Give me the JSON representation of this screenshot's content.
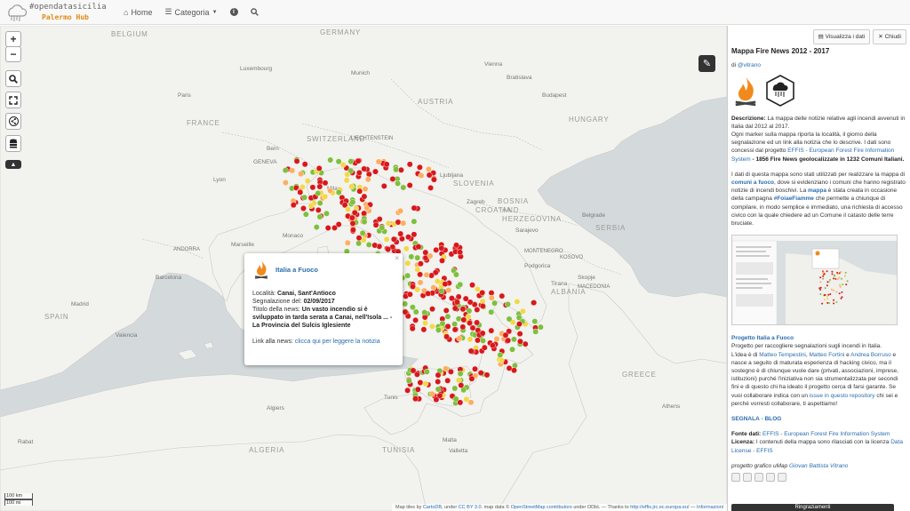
{
  "navbar": {
    "brand_title": "#opendatasicilia",
    "brand_subtitle": "Palermo Hub",
    "home_label": "Home",
    "categoria_label": "Categoria",
    "info_icon": "info-icon",
    "search_icon": "search-icon"
  },
  "map": {
    "labels": [
      {
        "text": "BELGIUM",
        "cls": "country"
      },
      {
        "text": "GERMANY",
        "cls": "country"
      },
      {
        "text": "Luxembourg",
        "cls": "city"
      },
      {
        "text": "Paris",
        "cls": "city"
      },
      {
        "text": "FRANCE",
        "cls": "country"
      },
      {
        "text": "Munich",
        "cls": "city"
      },
      {
        "text": "Vienna",
        "cls": "city"
      },
      {
        "text": "Bratislava",
        "cls": "city"
      },
      {
        "text": "Budapest",
        "cls": "city"
      },
      {
        "text": "AUSTRIA",
        "cls": "country"
      },
      {
        "text": "HUNGARY",
        "cls": "country"
      },
      {
        "text": "SWITZERLAND",
        "cls": "country"
      },
      {
        "text": "LIECHTENSTEIN",
        "cls": "small"
      },
      {
        "text": "Bern",
        "cls": "city"
      },
      {
        "text": "GENEVA",
        "cls": "city"
      },
      {
        "text": "Lyon",
        "cls": "city"
      },
      {
        "text": "Milan",
        "cls": "city"
      },
      {
        "text": "Ljubljana",
        "cls": "city"
      },
      {
        "text": "SLOVENIA",
        "cls": "country"
      },
      {
        "text": "Zagreb",
        "cls": "city"
      },
      {
        "text": "CROATIA",
        "cls": "country"
      },
      {
        "text": "BOSNIA",
        "cls": "country"
      },
      {
        "text": "AND",
        "cls": "country"
      },
      {
        "text": "HERZEGOVINA",
        "cls": "country"
      },
      {
        "text": "Sarajevo",
        "cls": "city"
      },
      {
        "text": "Belgrade",
        "cls": "city"
      },
      {
        "text": "SERBIA",
        "cls": "country"
      },
      {
        "text": "MONTENEGRO",
        "cls": "small"
      },
      {
        "text": "Podgorica",
        "cls": "city"
      },
      {
        "text": "KOSOVO",
        "cls": "small"
      },
      {
        "text": "Tirana",
        "cls": "city"
      },
      {
        "text": "ALBANIA",
        "cls": "country"
      },
      {
        "text": "Skopje",
        "cls": "city"
      },
      {
        "text": "MACEDONIA",
        "cls": "small"
      },
      {
        "text": "Monaco",
        "cls": "city"
      },
      {
        "text": "Marseille",
        "cls": "city"
      },
      {
        "text": "ANDORRA",
        "cls": "small"
      },
      {
        "text": "Barcelona",
        "cls": "city"
      },
      {
        "text": "Madrid",
        "cls": "city"
      },
      {
        "text": "SPAIN",
        "cls": "country"
      },
      {
        "text": "Valencia",
        "cls": "city"
      },
      {
        "text": "Algiers",
        "cls": "city"
      },
      {
        "text": "Tunis",
        "cls": "city"
      },
      {
        "text": "ALGERIA",
        "cls": "country"
      },
      {
        "text": "TUNISIA",
        "cls": "country"
      },
      {
        "text": "Rabat",
        "cls": "city"
      },
      {
        "text": "GREECE",
        "cls": "country"
      },
      {
        "text": "Athens",
        "cls": "city"
      },
      {
        "text": "Malta",
        "cls": "city"
      },
      {
        "text": "Valletta",
        "cls": "city"
      }
    ],
    "popup": {
      "title": "Italia a Fuoco",
      "localita_label": "Località:",
      "localita_value": "Canai, Sant'Antioco",
      "segnalazione_label": "Segnalazione del:",
      "segnalazione_value": "02/09/2017",
      "titolo_label": "Titolo della news:",
      "titolo_value": "Un vasto incendio si è sviluppato in tarda serata a Canai, nell'Isola ... - La Provincia del Sulcis Iglesiente",
      "link_label": "Link alla news:",
      "link_text": "clicca qui per leggere la notizia",
      "close": "×"
    },
    "attribution": {
      "prefix": "Map tiles by",
      "cartodb": "CartoDB",
      "under": ", under",
      "ccby": "CC BY 3.0",
      "mapdata": ". map data ©",
      "osm": "OpenStreetMap contributors",
      "odbl": "under ODbL — Thanks to",
      "effis": "http://effis.jrc.ec.europa.eu/",
      "sep": "—",
      "info": "Informazioni"
    },
    "scale": {
      "km": "100 km",
      "mi": "100 mi"
    },
    "colors": {
      "red": "#d7191c",
      "orange": "#fdae61",
      "yellow": "#f2d84a",
      "green": "#7fbf3f"
    }
  },
  "panel": {
    "visualizza_btn": "Visualizza i dati",
    "chiudi_btn": "Chiudi",
    "title": "Mappa Fire News 2012 - 2017",
    "by_prefix": "di",
    "by_author": "@vitrano",
    "desc_label": "Descrizione:",
    "desc_1": "La mappa delle notizie relative agli incendi avvenuti in Italia dal 2012 al 2017.",
    "desc_2": "Ogni marker sulla mappa riporta la località, il giorno della segnalazione ed un link alla notizia che lo descrive. I dati sono concessi dal progetto",
    "desc_effis": "EFFIS - European Forest Fire Information System",
    "desc_3": " - 1856 Fire News geolocalizzate in 1232 Comuni Italiani.",
    "p2_1": "I dati di questa mappa sono stati utilizzati per realizzare la mappa di",
    "p2_comuni": "comuni a fuoco",
    "p2_2": ", dove si evidenziano i comuni che hanno registrato notizie di incendi boschivi.",
    "p2_la": "La",
    "p2_mappa": "mappa",
    "p2_3": "è stata creata in occasione della campagna",
    "p2_foia": "#FoiaeFiamme",
    "p2_4": "che permette a chiunque di compilare, in modo semplice e immediato, una richiesta di accesso civico con la quale chiedere ad un Comune il catasto delle terre bruciate.",
    "progetto_title": "Progetto Italia a Fuoco",
    "pr_1": "Progetto per raccogliere segnalazioni sugli incendi in Italia.",
    "pr_2": "L'idea è di",
    "pr_a1": "Matteo Tempestini",
    "pr_a2": "Matteo Fortini",
    "pr_e": "e",
    "pr_a3": "Andrea Borruso",
    "pr_3": "e nasce a seguito di maturata esperienza di hacking civico, ma il sostegno è di chiunque vuole dare (privati, associazioni, imprese, istituzioni) purché l'iniziativa non sia strumentalizzata per secondi fini e di questo chi ha ideato il progetto cerca di farsi garante. Se vuoi collaborare indica con un",
    "pr_issue": "issue in questo repository",
    "pr_4": "chi sei e perché vorresti collaborare, ti aspettiamo!",
    "segnala": "SEGNALA",
    "dash": "-",
    "blog": "BLOG",
    "fonte_label": "Fonte dati:",
    "fonte_value": "EFFIS - European Forest Fire Information System",
    "licenza_label": "Licenza:",
    "licenza_text": "I contenuti della mappa sono rilasciati con la licenza",
    "licenza_link": "Data License - EFFIS",
    "credit_prefix": "progetto grafico uMap",
    "credit_name": "Giovan Battista Vitrano",
    "bottom_btn": "Ringraziamenti"
  }
}
